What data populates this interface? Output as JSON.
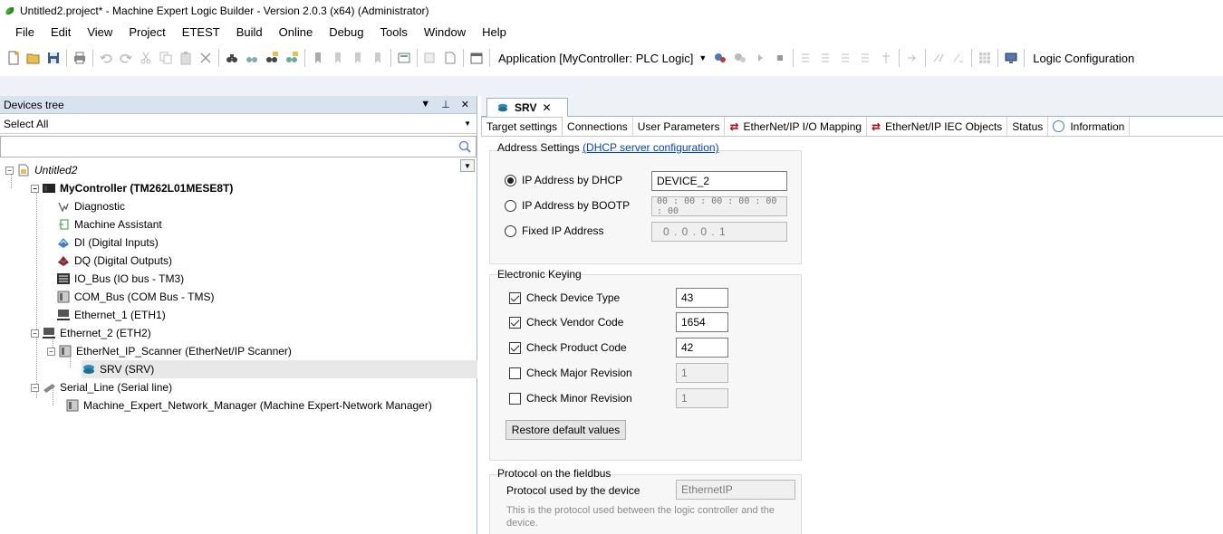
{
  "window": {
    "title": "Untitled2.project* - Machine Expert Logic Builder - Version 2.0.3 (x64) (Administrator)"
  },
  "menu": [
    "File",
    "Edit",
    "View",
    "Project",
    "ETEST",
    "Build",
    "Online",
    "Debug",
    "Tools",
    "Window",
    "Help"
  ],
  "toolbar": {
    "application_combo": "Application [MyController: PLC Logic]",
    "logic_configuration": "Logic Configuration"
  },
  "devices_tree": {
    "title": "Devices tree",
    "select_all": "Select All",
    "nodes": [
      {
        "label": "Untitled2"
      },
      {
        "label": "MyController (TM262L01MESE8T)"
      },
      {
        "label": "Diagnostic"
      },
      {
        "label": "Machine Assistant"
      },
      {
        "label": "DI (Digital Inputs)"
      },
      {
        "label": "DQ (Digital Outputs)"
      },
      {
        "label": "IO_Bus (IO bus - TM3)"
      },
      {
        "label": "COM_Bus (COM Bus - TMS)"
      },
      {
        "label": "Ethernet_1 (ETH1)"
      },
      {
        "label": "Ethernet_2 (ETH2)"
      },
      {
        "label": "EtherNet_IP_Scanner (EtherNet/IP Scanner)"
      },
      {
        "label": "SRV (SRV)"
      },
      {
        "label": "Serial_Line (Serial line)"
      },
      {
        "label": "Machine_Expert_Network_Manager (Machine Expert-Network Manager)"
      }
    ]
  },
  "editor": {
    "doc_tab": "SRV",
    "subtabs": [
      "Target settings",
      "Connections",
      "User Parameters",
      "EtherNet/IP I/O Mapping",
      "EtherNet/IP IEC Objects",
      "Status",
      "Information"
    ],
    "address_settings": {
      "title": "Address Settings",
      "link": "(DHCP server configuration)",
      "ip_dhcp_label": "IP Address by DHCP",
      "ip_dhcp_value": "DEVICE_2",
      "ip_bootp_label": "IP Address by BOOTP",
      "ip_bootp_value": "00 : 00 : 00 : 00 : 00 : 00",
      "fixed_ip_label": "Fixed IP Address",
      "fixed_ip_value": "0 . 0 . 0 . 1"
    },
    "electronic_keying": {
      "title": "Electronic Keying",
      "device_type_label": "Check Device Type",
      "device_type_value": "43",
      "vendor_code_label": "Check Vendor Code",
      "vendor_code_value": "1654",
      "product_code_label": "Check Product Code",
      "product_code_value": "42",
      "major_rev_label": "Check Major Revision",
      "major_rev_value": "1",
      "minor_rev_label": "Check Minor Revision",
      "minor_rev_value": "1",
      "restore_button": "Restore default values"
    },
    "protocol": {
      "title": "Protocol on the fieldbus",
      "used_label": "Protocol used by the device",
      "used_value": "EthernetIP",
      "note": "This is the protocol used between the logic controller and the device."
    }
  }
}
